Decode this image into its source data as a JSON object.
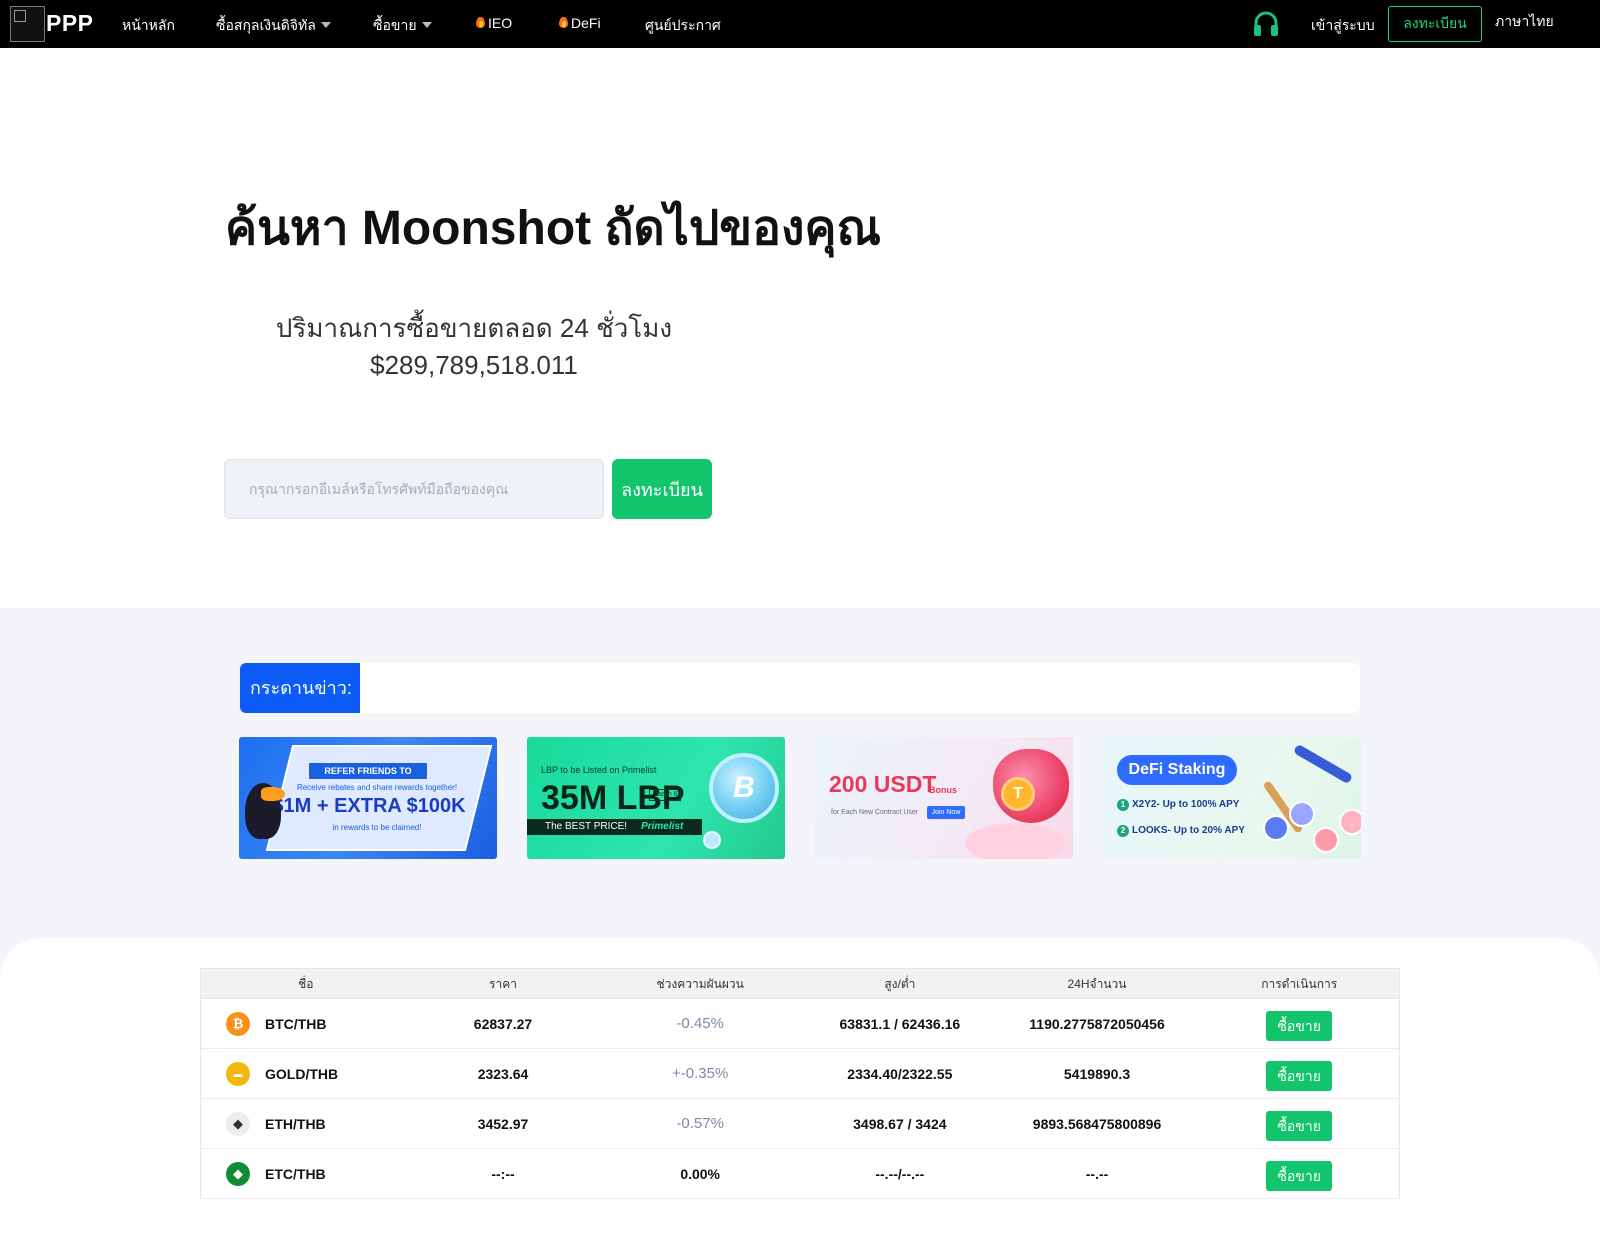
{
  "nav": {
    "brand": "PPP",
    "items": [
      {
        "label": "หน้าหลัก",
        "has_caret": false,
        "fire": false
      },
      {
        "label": "ซื้อสกุลเงินดิจิทัล",
        "has_caret": true,
        "fire": false
      },
      {
        "label": "ซื้อขาย",
        "has_caret": true,
        "fire": false
      },
      {
        "label": "IEO",
        "has_caret": false,
        "fire": true
      },
      {
        "label": "DeFi",
        "has_caret": false,
        "fire": true
      },
      {
        "label": "ศูนย์ประกาศ",
        "has_caret": false,
        "fire": false
      }
    ],
    "support_icon": "headset-icon",
    "login": "เข้าสู่ระบบ",
    "register": "ลงทะเบียน",
    "language": "ภาษาไทย",
    "accent_color": "#1fd27a"
  },
  "hero": {
    "title": "ค้นหา Moonshot ถัดไปของคุณ",
    "volume_label": "ปริมาณการซื้อขายตลอด 24 ชั่วโมง",
    "volume_value": "$289,789,518.011",
    "input_placeholder": "กรุณากรอกอีเมล์หรือโทรศัพท์มือถือของคุณ",
    "register_button": "ลงทะเบียน",
    "button_color": "#12c46b"
  },
  "news": {
    "label": "กระดานข่าว:",
    "label_color": "#0d5cf5"
  },
  "banners": [
    {
      "ribbon": "REFER FRIENDS TO TRADE!",
      "subtitle": "Receive rebates and share rewards together!",
      "headline": "$1M + EXTRA $100K",
      "note": "in rewards to be claimed!"
    },
    {
      "top": "LBP to be Listed on Primelist",
      "headline": "35M LBP",
      "date": "March 8",
      "strip": "The BEST PRICE!",
      "strip_brand": "Primelist",
      "coin_letter": "B"
    },
    {
      "headline": "200 USDT",
      "bonus": "Bonus",
      "subtitle": "for Each New Contract User",
      "cta": "Join Now",
      "coin_letter": "T"
    },
    {
      "headline": "DeFi Staking",
      "lines": [
        {
          "num": "1",
          "text": "X2Y2- Up to 100% APY"
        },
        {
          "num": "2",
          "text": "LOOKS- Up to 20% APY"
        }
      ]
    }
  ],
  "market": {
    "columns": [
      "ชื่อ",
      "ราคา",
      "ช่วงความผันผวน",
      "สูง/ต่ำ",
      "24Hจำนวน",
      "การดำเนินการ"
    ],
    "rows": [
      {
        "icon": "bitcoin-icon",
        "icon_color": "#f7931a",
        "icon_glyph": "₿",
        "pair": "BTC/THB",
        "price": "62837.27",
        "change": "-0.45%",
        "change_style": "muted",
        "high_low": "63831.1 / 62436.16",
        "volume": "1190.2775872050456",
        "action": "ซื้อขาย"
      },
      {
        "icon": "gold-icon",
        "icon_color": "#f2b90c",
        "icon_glyph": "▬",
        "pair": "GOLD/THB",
        "price": "2323.64",
        "change": "+-0.35%",
        "change_style": "muted",
        "high_low": "2334.40/2322.55",
        "volume": "5419890.3",
        "action": "ซื้อขาย"
      },
      {
        "icon": "ethereum-icon",
        "icon_color": "#ececec",
        "icon_glyph": "◆",
        "pair": "ETH/THB",
        "price": "3452.97",
        "change": "-0.57%",
        "change_style": "muted",
        "high_low": "3498.67 / 3424",
        "volume": "9893.568475800896",
        "action": "ซื้อขาย"
      },
      {
        "icon": "ethereum-classic-icon",
        "icon_color": "#138a36",
        "icon_glyph": "◆",
        "pair": "ETC/THB",
        "price": "--:--",
        "change": "0.00%",
        "change_style": "bold",
        "high_low": "--.--/--.--",
        "volume": "--.--",
        "action": "ซื้อขาย"
      }
    ]
  }
}
